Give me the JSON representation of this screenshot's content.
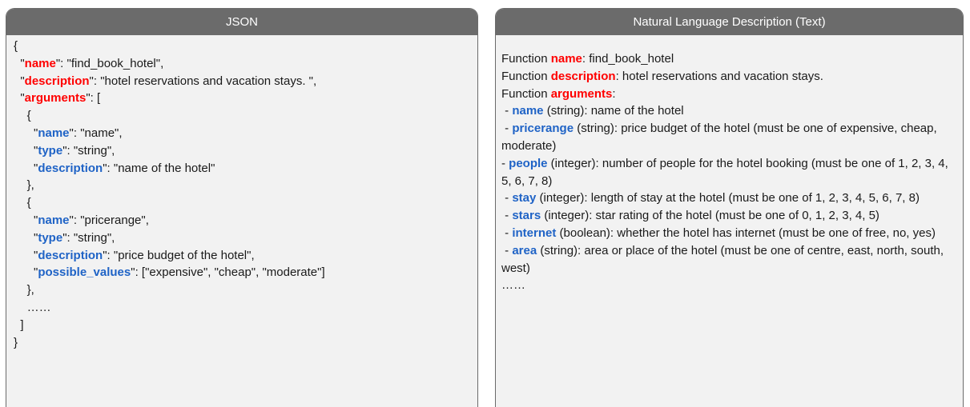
{
  "json_panel": {
    "title": "JSON",
    "lines": [
      "{",
      "  \"name\": \"find_book_hotel\",",
      "  \"description\": \"hotel reservations and vacation stays. \",",
      "  \"arguments\": [",
      "    {",
      "      \"name\": \"name\",",
      "      \"type\": \"string\",",
      "      \"description\": \"name of the hotel\"",
      "    },",
      "    {",
      "      \"name\": \"pricerange\",",
      "      \"type\": \"string\",",
      "      \"description\": \"price budget of the hotel\",",
      "      \"possible_values\": [\"expensive\", \"cheap\", \"moderate\"]",
      "    },",
      "    ……",
      "  ]",
      "}"
    ]
  },
  "text_panel": {
    "title": "Natural Language Description (Text)",
    "function_name_prefix": "Function ",
    "function_name_key": "name",
    "function_name_value": ": find_book_hotel",
    "function_desc_prefix": "Function ",
    "function_desc_key": "description",
    "function_desc_value": ": hotel reservations and vacation stays.",
    "function_args_prefix": "Function ",
    "function_args_key": "arguments",
    "function_args_suffix": ":",
    "args": [
      {
        "lead": " - ",
        "key": "name",
        "rest": " (string): name of the hotel"
      },
      {
        "lead": " - ",
        "key": "pricerange",
        "rest": " (string): price budget of the hotel (must be one of expensive, cheap, moderate)"
      },
      {
        "lead": "- ",
        "key": "people",
        "rest": " (integer): number of people for the hotel booking (must be one of 1, 2, 3, 4, 5, 6, 7, 8)"
      },
      {
        "lead": " - ",
        "key": "stay",
        "rest": " (integer): length of stay at the hotel (must be one of 1, 2, 3, 4, 5, 6, 7, 8)"
      },
      {
        "lead": " - ",
        "key": "stars",
        "rest": " (integer): star rating of the hotel (must be one of 0, 1, 2, 3, 4, 5)"
      },
      {
        "lead": " - ",
        "key": "internet",
        "rest": " (boolean): whether the hotel has internet (must be one of free, no, yes)"
      },
      {
        "lead": " - ",
        "key": "area",
        "rest": " (string): area or place of the hotel (must be one of centre, east, north, south, west)"
      }
    ],
    "ellipsis": "……"
  },
  "colors": {
    "header_bg": "#6b6b6b",
    "panel_bg": "#f2f2f2",
    "key_red": "#ff0000",
    "key_blue": "#1f63c6"
  }
}
